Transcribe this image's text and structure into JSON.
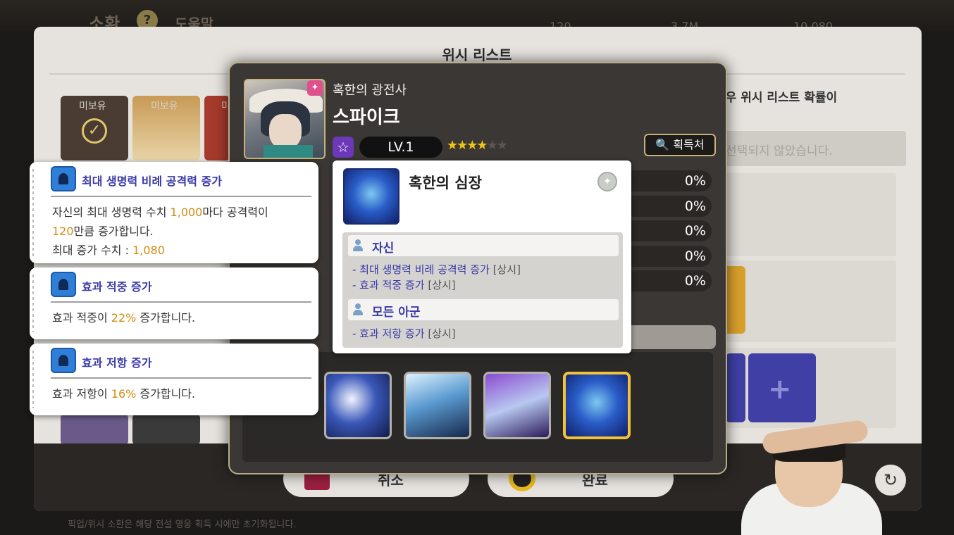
{
  "background": {
    "top_title": "소환",
    "help_label": "도움말",
    "resources": [
      "120",
      "3.7M",
      "10,080"
    ],
    "panel_title": "위시 리스트",
    "notice": "경우 위시 리스트 확률이",
    "unselected_text": "선택되지 않았습니다.",
    "slot_labels": [
      "미보유",
      "미보유",
      "미"
    ],
    "cancel_label": "취소",
    "confirm_label": "완료",
    "bottom_note": "픽업/위시 소환은 해당 전설 영웅 획득 시에만 초기화됩니다."
  },
  "hero": {
    "class": "혹한의 광전사",
    "name": "스파이크",
    "level": "LV.1",
    "stars_filled": 4,
    "stars_total": 6,
    "acquire_label": "획득처",
    "portrait_icon": "hero-portrait"
  },
  "percent_rows": [
    "0%",
    "0%",
    "0%",
    "0%",
    "0%"
  ],
  "equipment": {
    "name": "혹한의 심장",
    "icon": "frozen-heart-icon",
    "targets": [
      {
        "label": "자신",
        "effects": [
          {
            "name": "- 최대 생명력 비례 공격력 증가",
            "tag": "[상시]"
          },
          {
            "name": "- 효과 적중 증가",
            "tag": "[상시]"
          }
        ]
      },
      {
        "label": "모든 아군",
        "effects": [
          {
            "name": "- 효과 저항 증가",
            "tag": "[상시]"
          }
        ]
      }
    ],
    "thumbnails": [
      "blade-icon",
      "ice-crystal-icon",
      "shattered-ice-icon",
      "frozen-heart-icon"
    ],
    "selected_index": 3
  },
  "skills": [
    {
      "title": "최대 생명력 비례 공격력 증가",
      "desc_lines": [
        [
          "자신의 최대 생명력 수치 ",
          "1,000",
          "마다 공격력이"
        ],
        [
          "",
          "120",
          "만큼 증가합니다."
        ],
        [
          "최대 증가 수치 : ",
          "1,080",
          ""
        ]
      ]
    },
    {
      "title": "효과 적중 증가",
      "desc_lines": [
        [
          "효과 적중이 ",
          "22%",
          " 증가합니다."
        ]
      ]
    },
    {
      "title": "효과 저항 증가",
      "desc_lines": [
        [
          "효과 저항이 ",
          "16%",
          " 증가합니다."
        ]
      ]
    }
  ],
  "colors": {
    "accent_gold": "#f2c23a",
    "highlight_orange": "#d48a10",
    "skill_text_blue": "#3a3aa8",
    "panel_dark": "#3a3734"
  }
}
